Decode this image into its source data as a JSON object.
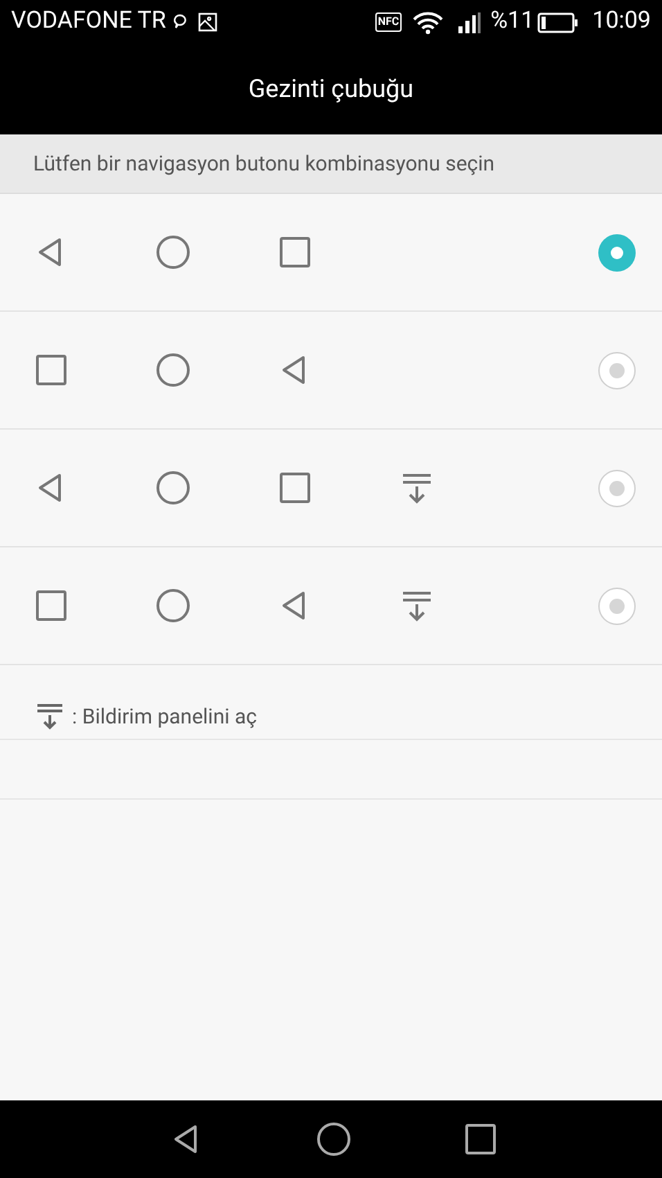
{
  "status_bar": {
    "carrier": "VODAFONE TR",
    "nfc": "NFC",
    "battery": "%11",
    "time": "10:09"
  },
  "title": "Gezinti çubuğu",
  "section_header": "Lütfen bir navigasyon butonu kombinasyonu seçin",
  "options": [
    {
      "buttons": [
        {
          "kind": "back"
        },
        {
          "kind": "home"
        },
        {
          "kind": "recent"
        }
      ],
      "selected": true
    },
    {
      "buttons": [
        {
          "kind": "recent"
        },
        {
          "kind": "home"
        },
        {
          "kind": "back"
        }
      ],
      "selected": false
    },
    {
      "buttons": [
        {
          "kind": "back"
        },
        {
          "kind": "home"
        },
        {
          "kind": "recent"
        },
        {
          "kind": "notification"
        }
      ],
      "selected": false
    },
    {
      "buttons": [
        {
          "kind": "recent"
        },
        {
          "kind": "home"
        },
        {
          "kind": "back"
        },
        {
          "kind": "notification"
        }
      ],
      "selected": false
    }
  ],
  "legend": ": Bildirim panelini aç",
  "nav_bar": [
    {
      "kind": "back"
    },
    {
      "kind": "home"
    },
    {
      "kind": "recent"
    }
  ]
}
